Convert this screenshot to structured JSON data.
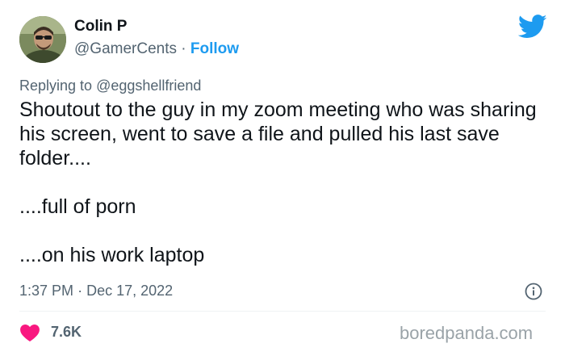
{
  "author": {
    "name": "Colin P",
    "handle": "@GamerCents",
    "separator": "·",
    "follow_label": "Follow"
  },
  "reply": {
    "prefix": "Replying to",
    "mention": "@eggshellfriend"
  },
  "tweet": {
    "line1": "Shoutout to the guy in my zoom meeting who was sharing his screen, went to save a file and pulled his last save folder....",
    "line2": "....full of porn",
    "line3": "....on his work laptop"
  },
  "meta": {
    "time": "1:37 PM",
    "separator": "·",
    "date": "Dec 17, 2022"
  },
  "engagement": {
    "likes": "7.6K"
  },
  "watermark": "boredpanda.com",
  "icons": {
    "brand": "twitter-bird-icon",
    "info": "info-icon",
    "like": "heart-icon"
  },
  "colors": {
    "accent": "#1d9bf0",
    "heart": "#f91880",
    "secondary_text": "#536471",
    "primary_text": "#0f1419"
  }
}
